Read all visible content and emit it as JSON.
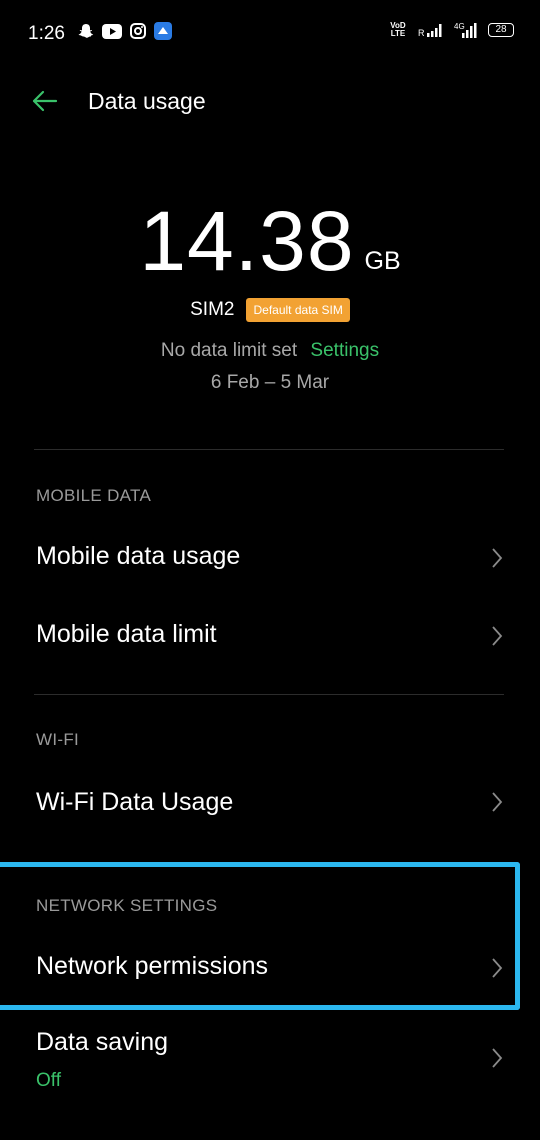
{
  "status_bar": {
    "time": "1:26",
    "volte": "VoD\nLTE",
    "sim_r": "R",
    "net": "4G",
    "battery": "28"
  },
  "app_bar": {
    "title": "Data usage"
  },
  "summary": {
    "usage_value": "14.38",
    "usage_unit": "GB",
    "sim_name": "SIM2",
    "sim_badge": "Default data SIM",
    "limit_text": "No data limit set",
    "limit_link": "Settings",
    "range": "6 Feb – 5 Mar"
  },
  "sections": {
    "mobile_data": {
      "label": "MOBILE DATA",
      "items": [
        "Mobile data usage",
        "Mobile data limit"
      ]
    },
    "wifi": {
      "label": "WI-FI",
      "items": [
        "Wi-Fi Data Usage"
      ]
    },
    "network_settings": {
      "label": "NETWORK SETTINGS",
      "items": [
        "Network permissions"
      ]
    },
    "data_saving": {
      "label": "Data saving",
      "status": "Off"
    }
  },
  "colors": {
    "accent_green": "#3ac26a",
    "badge_orange": "#f2a233",
    "highlight_blue": "#2bb7ef"
  }
}
